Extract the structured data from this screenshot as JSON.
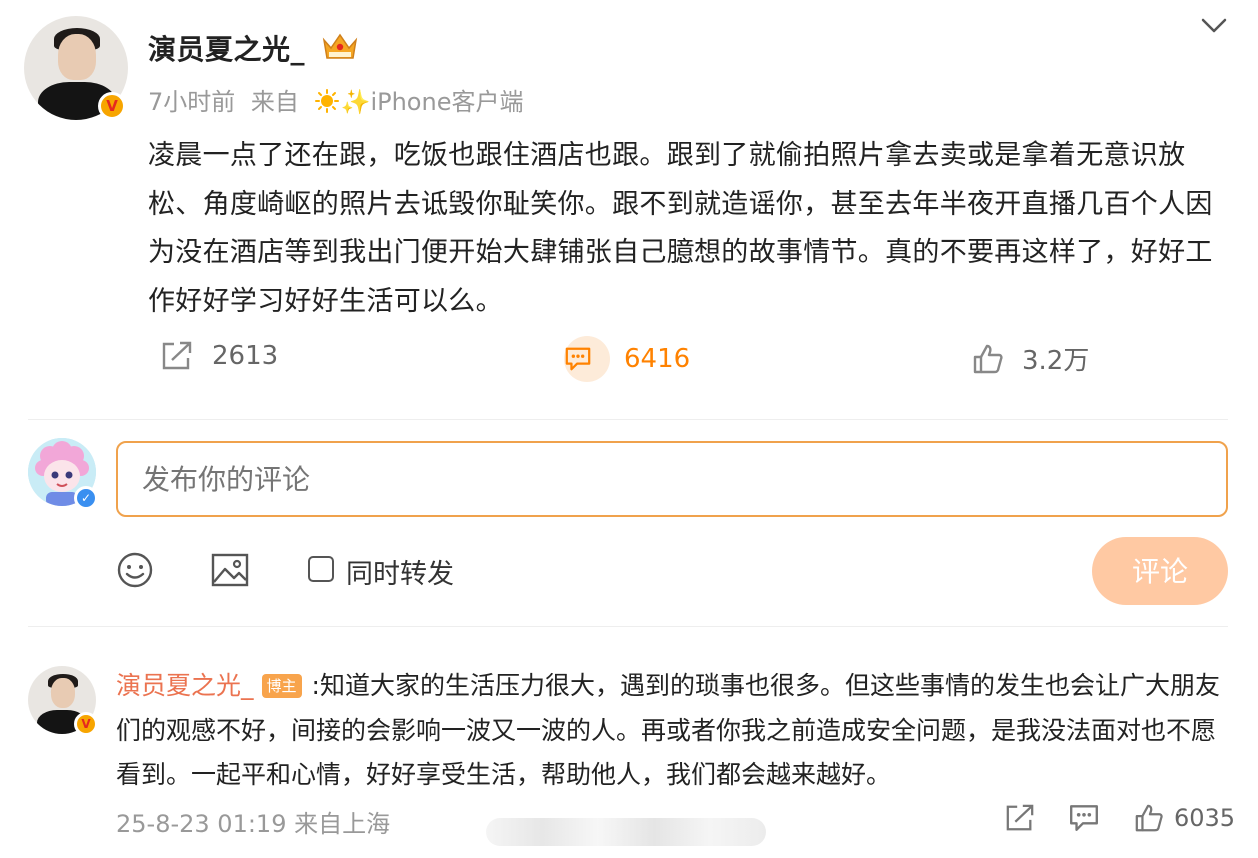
{
  "post": {
    "author": "演员夏之光_",
    "time": "7小时前",
    "source_prefix": "来自",
    "source": "✨iPhone客户端",
    "text": "凌晨一点了还在跟，吃饭也跟住酒店也跟。跟到了就偷拍照片拿去卖或是拿着无意识放松、角度崎岖的照片去诋毁你耻笑你。跟不到就造谣你，甚至去年半夜开直播几百个人因为没在酒店等到我出门便开始大肆铺张自己臆想的故事情节。真的不要再这样了，好好工作好好学习好好生活可以么。",
    "verified_badge": "V"
  },
  "actions": {
    "forward_count": "2613",
    "comment_count": "6416",
    "like_count": "3.2万"
  },
  "composer": {
    "placeholder": "发布你的评论",
    "repost_label": "同时转发",
    "submit_label": "评论"
  },
  "comment": {
    "author": "演员夏之光_",
    "badge": "博主",
    "text": ":知道大家的生活压力很大，遇到的琐事也很多。但这些事情的发生也会让广大朋友们的观感不好，间接的会影响一波又一波的人。再或者你我之前造成安全问题，是我没法面对也不愿看到。一起平和心情，好好享受生活，帮助他人，我们都会越来越好。",
    "time": "25-8-23 01:19",
    "location": "来自上海",
    "like_count": "6035"
  },
  "colors": {
    "accent": "#ff8200",
    "name_link": "#eb7350",
    "input_border": "#f0a24c",
    "submit_bg": "#ffc9a3"
  }
}
